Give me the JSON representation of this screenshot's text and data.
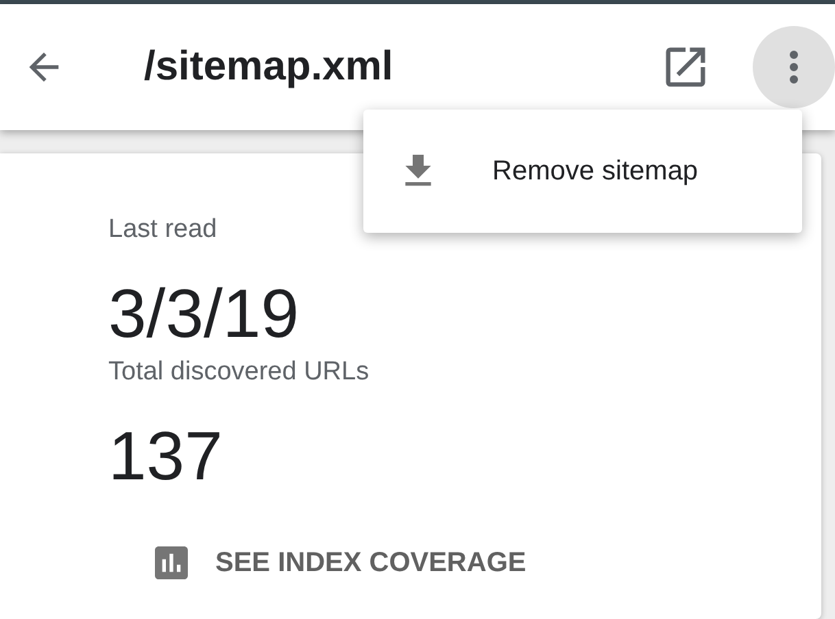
{
  "header": {
    "title": "/sitemap.xml"
  },
  "menu": {
    "open": true,
    "items": [
      {
        "label": "Remove sitemap"
      }
    ]
  },
  "card": {
    "fields": [
      {
        "label": "Last read",
        "value": "3/3/19"
      },
      {
        "label": "Total discovered URLs",
        "value": "137"
      }
    ],
    "link": {
      "label": "SEE INDEX COVERAGE"
    }
  }
}
